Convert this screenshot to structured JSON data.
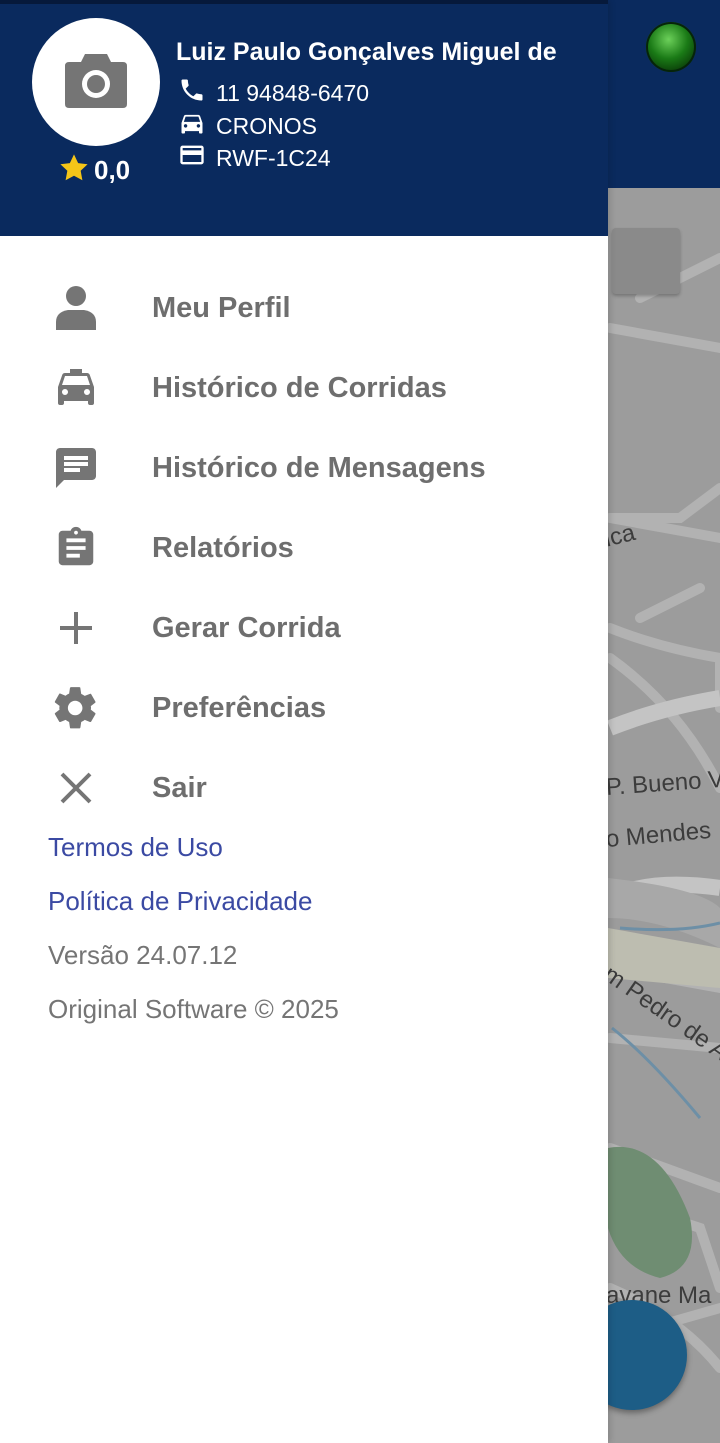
{
  "header": {
    "driver_name": "Luiz Paulo Gonçalves Miguel de",
    "rating": "0,0",
    "phone": "11 94848-6470",
    "vehicle": "CRONOS",
    "plate": "RWF-1C24",
    "avatar_icon": "camera-icon",
    "rating_icon": "star-icon"
  },
  "menu": {
    "items": [
      {
        "label": "Meu Perfil",
        "icon": "person-icon"
      },
      {
        "label": "Histórico de Corridas",
        "icon": "car-icon"
      },
      {
        "label": "Histórico de Mensagens",
        "icon": "message-icon"
      },
      {
        "label": "Relatórios",
        "icon": "clipboard-icon"
      },
      {
        "label": "Gerar Corrida",
        "icon": "plus-icon"
      },
      {
        "label": "Preferências",
        "icon": "gear-icon"
      },
      {
        "label": "Sair",
        "icon": "close-icon"
      }
    ]
  },
  "footer": {
    "terms": "Termos de Uso",
    "privacy": "Política de Privacidade",
    "version": "Versão 24.07.12",
    "copyright": "Original Software © 2025"
  },
  "background": {
    "map_labels": [
      "ica",
      "P. Bueno V",
      "o Mendes",
      "m Pedro de Alc",
      "avane Ma"
    ]
  },
  "colors": {
    "header_bg": "#0a2a5e",
    "menu_text": "#6e6e6e",
    "link": "#3b4aa3",
    "star": "#f5c518",
    "status_light": "#2e9a24"
  }
}
